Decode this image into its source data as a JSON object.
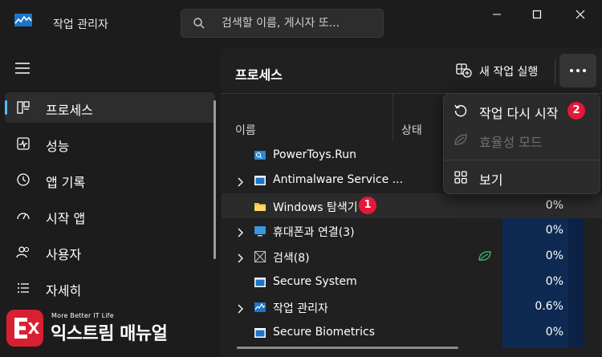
{
  "app": {
    "title": "작업 관리자"
  },
  "search": {
    "placeholder": "검색할 이름, 게시자 또..."
  },
  "sidebar": {
    "items": [
      {
        "label": "프로세스",
        "icon": "processes-icon",
        "active": true
      },
      {
        "label": "성능",
        "icon": "performance-icon",
        "active": false
      },
      {
        "label": "앱 기록",
        "icon": "app-history-icon",
        "active": false
      },
      {
        "label": "시작 앱",
        "icon": "startup-apps-icon",
        "active": false
      },
      {
        "label": "사용자",
        "icon": "users-icon",
        "active": false
      },
      {
        "label": "자세히",
        "icon": "details-icon",
        "active": false
      }
    ]
  },
  "main": {
    "title": "프로세스",
    "run_task_label": "새 작업 실행",
    "columns": {
      "name": "이름",
      "status": "상태"
    }
  },
  "processes": [
    {
      "name": "PowerToys.Run",
      "expandable": false,
      "cpu": ""
    },
    {
      "name": "Antimalware Service ...",
      "expandable": true,
      "cpu": ""
    },
    {
      "name": "Windows 탐색기",
      "expandable": false,
      "cpu": "0%"
    },
    {
      "name": "휴대폰과 연결(3)",
      "expandable": true,
      "cpu": "0%"
    },
    {
      "name": "검색(8)",
      "expandable": true,
      "cpu": "0%"
    },
    {
      "name": "Secure System",
      "expandable": false,
      "cpu": "0%"
    },
    {
      "name": "작업 관리자",
      "expandable": true,
      "cpu": "0.6%"
    },
    {
      "name": "Secure Biometrics",
      "expandable": false,
      "cpu": "0%"
    }
  ],
  "context_menu": {
    "items": [
      {
        "label": "작업 다시 시작",
        "enabled": true
      },
      {
        "label": "효율성 모드",
        "enabled": false
      },
      {
        "label": "보기",
        "enabled": true
      }
    ]
  },
  "badges": {
    "first": "1",
    "second": "2"
  },
  "colors": {
    "accent": "#4cc2ff",
    "badge": "#e8163a",
    "cpu_column": "#0f2a52"
  },
  "watermark": {
    "small": "More Better IT Life",
    "big": "익스트림 매뉴얼"
  }
}
